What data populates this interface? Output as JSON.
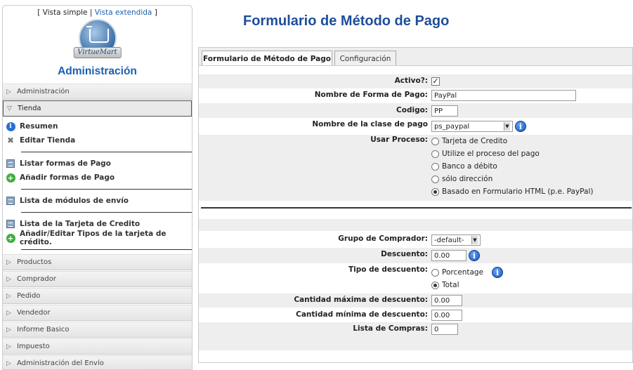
{
  "sidebar": {
    "view_links": {
      "open": "[ ",
      "simple": "Vista simple",
      "sep": " | ",
      "extended": "Vista extendida",
      "close": " ]"
    },
    "logo_text": "VirtueMart",
    "title": "Administración",
    "sections_top": [
      {
        "label": "Administración"
      }
    ],
    "active_section": "Tienda",
    "tienda_items": [
      {
        "label": "Resumen",
        "icon": "info-icon"
      },
      {
        "label": "Editar Tienda",
        "icon": "tools-icon"
      },
      {
        "label": "Listar formas de Pago",
        "icon": "list-icon"
      },
      {
        "label": "Añadir formas de Pago",
        "icon": "add-icon"
      },
      {
        "label": "Lista de módulos de envío",
        "icon": "list-icon"
      },
      {
        "label": "Lista de la Tarjeta de Credito",
        "icon": "list-icon"
      },
      {
        "label": "Añadir/Editar Tipos de la tarjeta de crédito.",
        "icon": "add-icon"
      }
    ],
    "sections_bottom": [
      {
        "label": "Productos"
      },
      {
        "label": "Comprador"
      },
      {
        "label": "Pedido"
      },
      {
        "label": "Vendedor"
      },
      {
        "label": "Informe Basico"
      },
      {
        "label": "Impuesto"
      },
      {
        "label": "Administración del Envío"
      }
    ]
  },
  "page_title": "Formulario de Método de Pago",
  "tabs": [
    {
      "label": "Formulario de Método de Pago",
      "active": true
    },
    {
      "label": "Configuración",
      "active": false
    }
  ],
  "form": {
    "activo": {
      "label": "Activo?:",
      "checked": true
    },
    "nombre": {
      "label": "Nombre de Forma de Pago:",
      "value": "PayPal"
    },
    "codigo": {
      "label": "Codigo:",
      "value": "PP"
    },
    "clase": {
      "label": "Nombre de la clase de pago",
      "value": "ps_paypal"
    },
    "proceso": {
      "label": "Usar Proceso:",
      "options": [
        {
          "label": "Tarjeta de Credito",
          "checked": false
        },
        {
          "label": "Utilize el proceso del pago",
          "checked": false
        },
        {
          "label": "Banco a débito",
          "checked": false
        },
        {
          "label": "sólo dirección",
          "checked": false
        },
        {
          "label": "Basado en Formulario HTML (p.e. PayPal)",
          "checked": true
        }
      ]
    },
    "grupo": {
      "label": "Grupo de Comprador:",
      "value": "-default-"
    },
    "descuento": {
      "label": "Descuento:",
      "value": "0.00"
    },
    "tipo_descuento": {
      "label": "Tipo de descuento:",
      "options": [
        {
          "label": "Porcentage",
          "checked": false
        },
        {
          "label": "Total",
          "checked": true
        }
      ]
    },
    "max_desc": {
      "label": "Cantidad máxima de descuento:",
      "value": "0.00"
    },
    "min_desc": {
      "label": "Cantidad mínima de descuento:",
      "value": "0.00"
    },
    "lista_compras": {
      "label": "Lista de Compras:",
      "value": "0"
    }
  }
}
